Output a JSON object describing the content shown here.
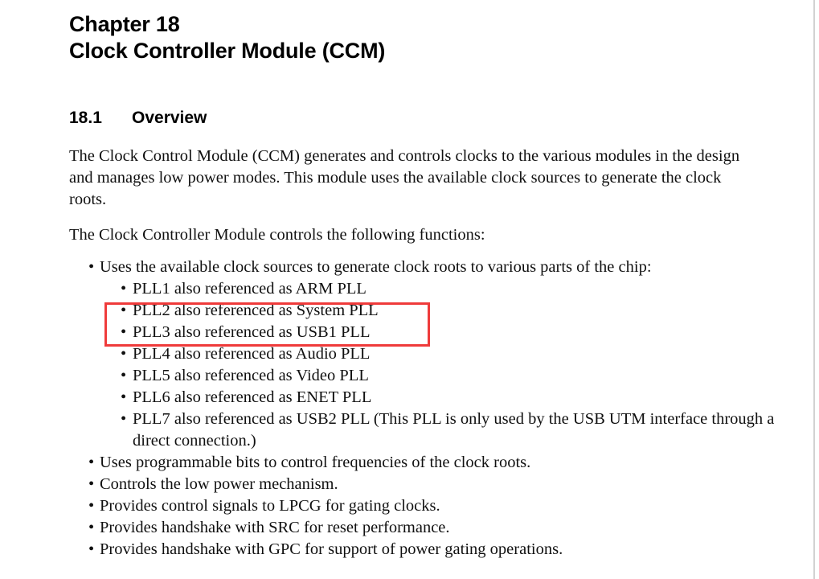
{
  "document": {
    "chapter_title_line1": "Chapter 18",
    "chapter_title_line2": "Clock Controller Module (CCM)",
    "section": {
      "number": "18.1",
      "title": "Overview"
    },
    "paragraphs": [
      "The Clock Control Module (CCM) generates and controls clocks to the various modules in the design and manages low power modes. This module uses the available clock sources to generate the clock roots.",
      "The Clock Controller Module controls the following functions:"
    ],
    "bullet_char": "•",
    "bullets": [
      {
        "text": "Uses the available clock sources to generate clock roots to various parts of the chip:",
        "children": [
          "PLL1 also referenced as ARM PLL",
          "PLL2 also referenced as System PLL",
          "PLL3 also referenced as USB1 PLL",
          "PLL4 also referenced as Audio PLL",
          "PLL5 also referenced as Video PLL",
          "PLL6 also referenced as ENET PLL",
          "PLL7 also referenced as USB2 PLL (This PLL is only used by the USB UTM interface through a direct connection.)"
        ]
      },
      {
        "text": "Uses programmable bits to control frequencies of the clock roots.",
        "children": []
      },
      {
        "text": "Controls the low power mechanism.",
        "children": []
      },
      {
        "text": "Provides control signals to LPCG for gating clocks.",
        "children": []
      },
      {
        "text": "Provides handshake with SRC for reset performance.",
        "children": []
      },
      {
        "text": "Provides handshake with GPC for support of power gating operations.",
        "children": []
      }
    ]
  },
  "annotation": {
    "type": "rectangle-highlight",
    "color": "#ef3b3b",
    "border_width_px": 3,
    "covers": [
      "PLL2 also referenced as System PLL",
      "PLL3 also referenced as USB1 PLL"
    ]
  },
  "colors": {
    "page_background": "#ffffff",
    "text": "#101010",
    "heading": "#000000",
    "annotation_red": "#ef3b3b",
    "page_edge": "#d2d2d2"
  }
}
